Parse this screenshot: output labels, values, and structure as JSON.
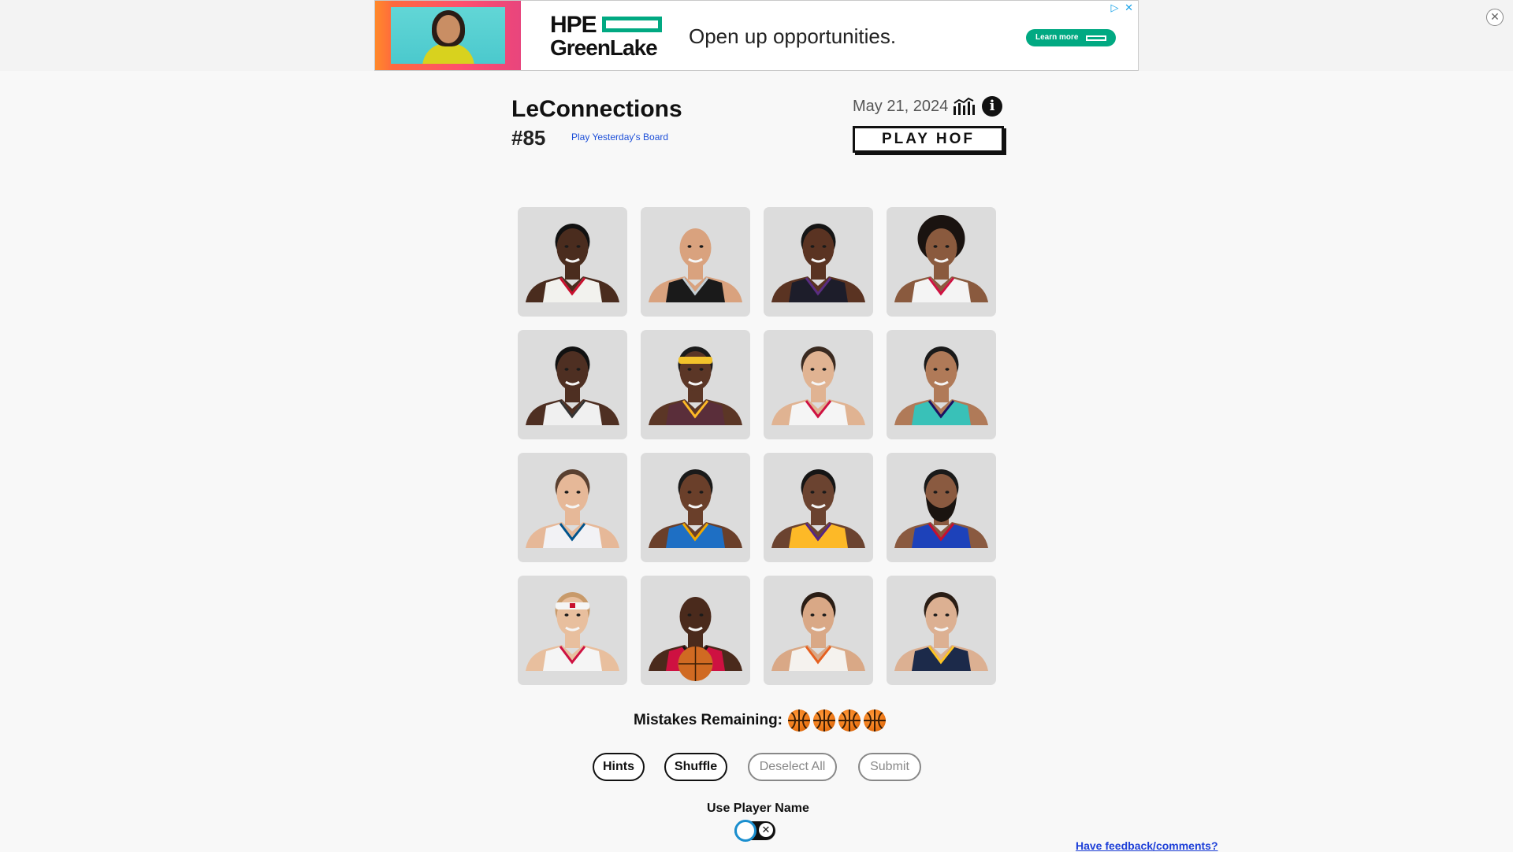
{
  "ad": {
    "brand_line1": "HPE",
    "brand_line2": "GreenLake",
    "headline": "Open up opportunities.",
    "cta": "Learn more",
    "adchoices_glyph": "▷ ✕",
    "close_glyph": "✕",
    "accent_color": "#01a982"
  },
  "header": {
    "title": "LeConnections",
    "puzzle_number": "#85",
    "yesterday_link": "Play Yesterday's Board",
    "date": "May 21, 2024",
    "stats_icon": "bar-chart-icon",
    "info_icon": "info-icon",
    "info_glyph": "i",
    "hof_button": "PLAY HOF"
  },
  "tiles": [
    {
      "skin": "#4a2c1e",
      "hair": "#111111",
      "jersey": "#f2f2ee",
      "trim": "#c8102e",
      "extra": "none"
    },
    {
      "skin": "#d9a27e",
      "hair": "none",
      "jersey": "#1a1a1a",
      "trim": "#c4ced4",
      "extra": "none"
    },
    {
      "skin": "#5a3322",
      "hair": "#151515",
      "jersey": "#1d1d2a",
      "trim": "#5a2d81",
      "extra": "none"
    },
    {
      "skin": "#8a5a3e",
      "hair": "#1a1310",
      "jersey": "#f4f4f4",
      "trim": "#ce1141",
      "extra": "curly"
    },
    {
      "skin": "#4e2f22",
      "hair": "#111111",
      "jersey": "#f0f0f0",
      "trim": "#333333",
      "extra": "none"
    },
    {
      "skin": "#5b3626",
      "hair": "#1a1a1a",
      "jersey": "#5a2e3a",
      "trim": "#fdb927",
      "extra": "headband"
    },
    {
      "skin": "#e0b392",
      "hair": "#3a2a20",
      "jersey": "#f5f5f5",
      "trim": "#ce1141",
      "extra": "none"
    },
    {
      "skin": "#b07a58",
      "hair": "#1a1a1a",
      "jersey": "#39c1b8",
      "trim": "#1d1160",
      "extra": "none"
    },
    {
      "skin": "#e6b898",
      "hair": "#5a4030",
      "jersey": "#f2f2f5",
      "trim": "#00538c",
      "extra": "none"
    },
    {
      "skin": "#6a3f2a",
      "hair": "#1a1a1a",
      "jersey": "#1e6fc4",
      "trim": "#f2a900",
      "extra": "none"
    },
    {
      "skin": "#6b4330",
      "hair": "#151515",
      "jersey": "#fdb927",
      "trim": "#552583",
      "extra": "none"
    },
    {
      "skin": "#8a5a40",
      "hair": "#1a1a1a",
      "jersey": "#1d42ba",
      "trim": "#c8102e",
      "extra": "beard"
    },
    {
      "skin": "#e8bf9e",
      "hair": "#c89a6a",
      "jersey": "#f5f5f5",
      "trim": "#ce1141",
      "extra": "headband-white"
    },
    {
      "skin": "#4a2a1c",
      "hair": "none",
      "jersey": "#ce1141",
      "trim": "#111111",
      "extra": "ball"
    },
    {
      "skin": "#d9a886",
      "hair": "#2a1d15",
      "jersey": "#f5f2ee",
      "trim": "#e56020",
      "extra": "none"
    },
    {
      "skin": "#dcb092",
      "hair": "#2a1d15",
      "jersey": "#1c2a4a",
      "trim": "#fec524",
      "extra": "none"
    }
  ],
  "controls": {
    "mistakes_label": "Mistakes Remaining:",
    "mistakes_remaining": 4,
    "hints": "Hints",
    "shuffle": "Shuffle",
    "deselect_all": "Deselect All",
    "submit": "Submit",
    "toggle_label": "Use Player Name",
    "toggle_on": false,
    "toggle_glyph": "✕",
    "feedback_link": "Have feedback/comments?"
  }
}
